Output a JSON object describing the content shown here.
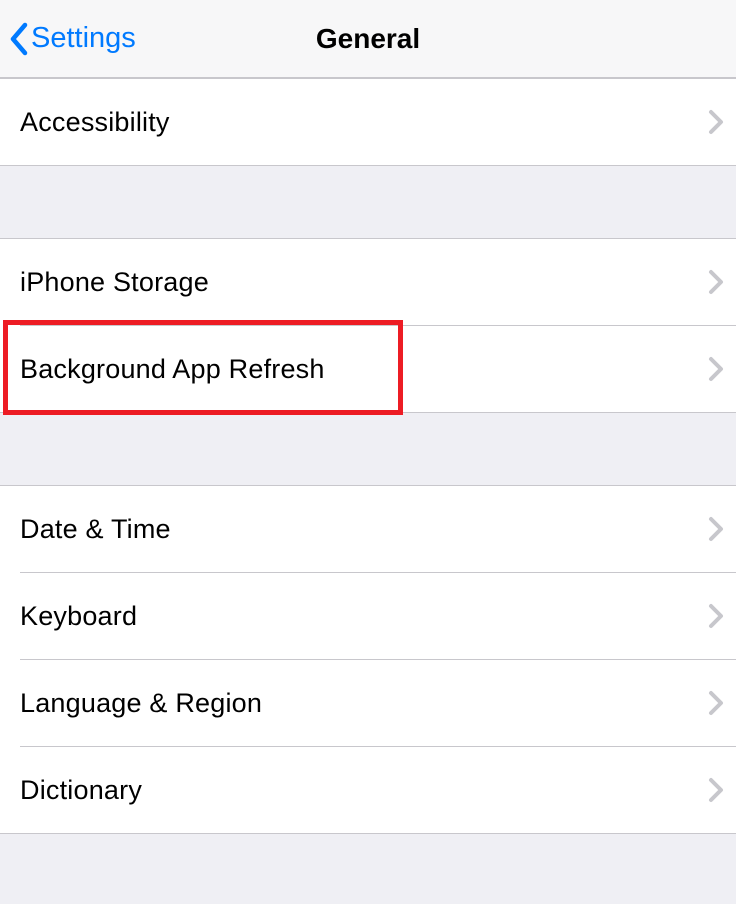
{
  "header": {
    "back_label": "Settings",
    "title": "General"
  },
  "sections": {
    "a": {
      "accessibility": "Accessibility"
    },
    "b": {
      "iphone_storage": "iPhone Storage",
      "background_app_refresh": "Background App Refresh"
    },
    "c": {
      "date_time": "Date & Time",
      "keyboard": "Keyboard",
      "language_region": "Language & Region",
      "dictionary": "Dictionary"
    }
  }
}
